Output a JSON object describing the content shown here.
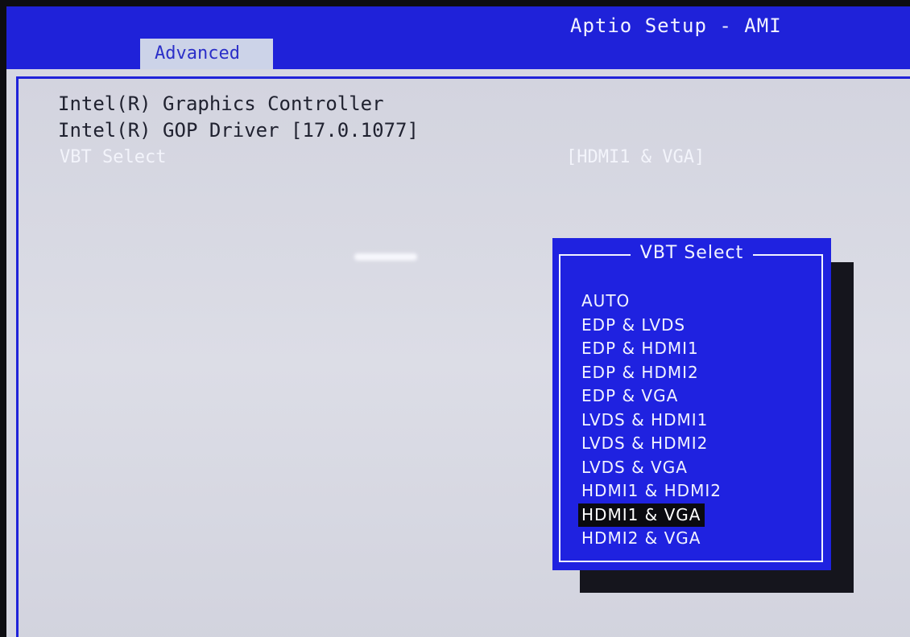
{
  "app": {
    "title": "Aptio Setup - AMI"
  },
  "tabs": [
    {
      "label": "Advanced",
      "active": true
    }
  ],
  "info": {
    "controller": "Intel(R) Graphics Controller",
    "gop_driver": "Intel(R) GOP Driver [17.0.1077]"
  },
  "setting": {
    "label": "VBT Select",
    "value": "[HDMI1 & VGA]"
  },
  "popup": {
    "title": "VBT Select",
    "options": [
      "AUTO",
      "EDP & LVDS",
      "EDP & HDMI1",
      "EDP & HDMI2",
      "EDP & VGA",
      "LVDS & HDMI1",
      "LVDS & HDMI2",
      "LVDS & VGA",
      "HDMI1 & HDMI2",
      "HDMI1 & VGA",
      "HDMI2 & VGA"
    ],
    "selected_index": 9
  },
  "colors": {
    "bios_blue": "#1f22d9",
    "panel_gray": "#d6d7e2",
    "highlight": "#0a0a10",
    "text_white": "#f2f3ff"
  }
}
